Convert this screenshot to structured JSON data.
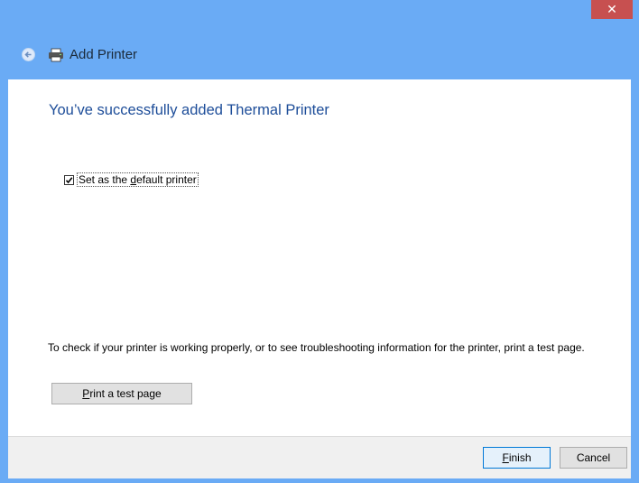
{
  "window": {
    "close_glyph": "✕"
  },
  "nav": {
    "title": "Add Printer",
    "back_icon": "back-arrow-icon",
    "app_icon": "printer-icon"
  },
  "content": {
    "heading": "You’ve successfully added Thermal Printer",
    "default_printer": {
      "label_pre": "Set as the ",
      "label_key": "d",
      "label_post": "efault printer",
      "checked": true
    },
    "info_text": "To check if your printer is working properly, or to see troubleshooting information for the printer, print a test page.",
    "test_button": {
      "key": "P",
      "rest": "rint a test page"
    }
  },
  "footer": {
    "finish": {
      "key": "F",
      "rest": "inish"
    },
    "cancel_label": "Cancel"
  },
  "colors": {
    "titlebar": "#6aabf5",
    "heading": "#1d4d99",
    "close": "#c75050",
    "focus": "#0078d7"
  }
}
